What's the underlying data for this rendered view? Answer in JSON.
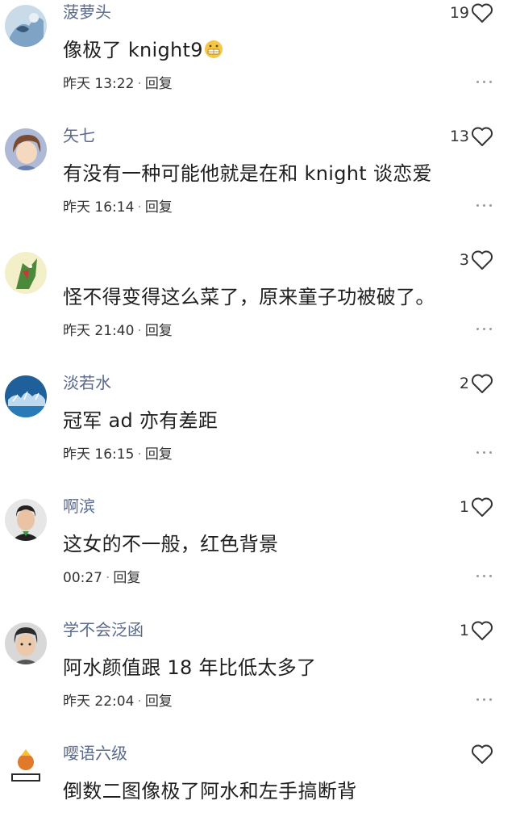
{
  "comments": [
    {
      "username": "菠萝头",
      "text": "像极了 knight9",
      "emoji": "grimace-emoji",
      "time": "昨天 13:22",
      "reply": "回复",
      "likes": "19",
      "avatar_colors": [
        "#c9dbe8",
        "#3a5a7a"
      ]
    },
    {
      "username": "矢七",
      "text": "有没有一种可能他就是在和 knight 谈恋爱",
      "time": "昨天 16:14",
      "reply": "回复",
      "likes": "13",
      "avatar_colors": [
        "#aeb9d6",
        "#7a4b30"
      ]
    },
    {
      "username": "",
      "text": "怪不得变得这么菜了，原来童子功被破了。",
      "time": "昨天 21:40",
      "reply": "回复",
      "likes": "3",
      "avatar_colors": [
        "#f2efc9",
        "#4a8a3a"
      ]
    },
    {
      "username": "淡若水",
      "text": "冠军 ad 亦有差距",
      "time": "昨天 16:15",
      "reply": "回复",
      "likes": "2",
      "avatar_colors": [
        "#1f5f9a",
        "#ffffff"
      ]
    },
    {
      "username": "啊滨",
      "text": "这女的不一般，红色背景",
      "time": "00:27",
      "reply": "回复",
      "likes": "1",
      "avatar_colors": [
        "#e6e6e6",
        "#222222"
      ]
    },
    {
      "username": "学不会泛函",
      "text": "阿水颜值跟 18 年比低太多了",
      "time": "昨天 22:04",
      "reply": "回复",
      "likes": "1",
      "avatar_colors": [
        "#d8d8d8",
        "#2a2a2a"
      ]
    },
    {
      "username": "嘤语六级",
      "text": "倒数二图像极了阿水和左手搞断背",
      "time": "",
      "reply": "",
      "likes": "",
      "avatar_colors": [
        "#ffffff",
        "#e07a2a"
      ]
    }
  ],
  "colors": {
    "username": "#5b6a8c",
    "text": "#1f1f1f",
    "meta": "#333333"
  }
}
